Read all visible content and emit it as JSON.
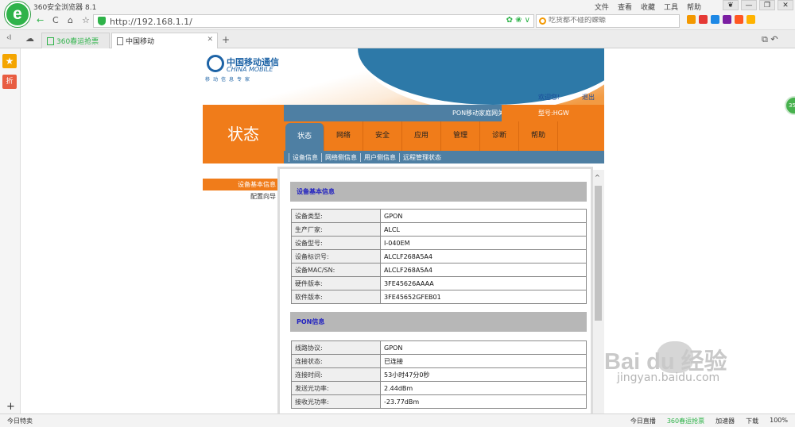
{
  "browser": {
    "logo_letter": "e",
    "app_name": "360安全浏览器 8.1",
    "top_menu": [
      "文件",
      "查看",
      "收藏",
      "工具",
      "帮助"
    ],
    "window_controls": [
      "❦",
      "—",
      "❐",
      "✕"
    ],
    "nav": {
      "back": "←",
      "refresh": "C",
      "home": "⌂",
      "fav": "☆",
      "left": "‹I",
      "cloud": "☁"
    },
    "url": "http://192.168.1.1/",
    "url_icons": "✿ ❀ ∨",
    "search_placeholder": "吃货都不碰的蝾螈",
    "tabs": [
      {
        "label": "360春运抢票"
      },
      {
        "label": "中国移动"
      }
    ],
    "tab_close": "✕",
    "new_tab": "+",
    "right_tools": "⧉ ↶",
    "sidebar_add": "+",
    "ext_badge": "35",
    "ext_colors": [
      "#f39800",
      "#e53935",
      "#1e88e5",
      "#7b1fa2",
      "#ff5722",
      "#ffb300"
    ]
  },
  "router_page": {
    "brand_cn": "中国移动通信",
    "brand_en": "CHINA MOBILE",
    "brand_slogan": "移动信息专家",
    "welcome": "欢迎您!",
    "logout": "退出",
    "section_title": "状态",
    "device_title": "PON移动家庭网关",
    "model_label": "型号:HGW",
    "main_nav": [
      {
        "label": "状态",
        "active": true
      },
      {
        "label": "网络",
        "active": false
      },
      {
        "label": "安全",
        "active": false
      },
      {
        "label": "应用",
        "active": false
      },
      {
        "label": "管理",
        "active": false
      },
      {
        "label": "诊断",
        "active": false
      },
      {
        "label": "帮助",
        "active": false
      }
    ],
    "sub_nav": [
      "设备信息",
      "网络侧信息",
      "用户侧信息",
      "远程管理状态"
    ],
    "left_menu": [
      {
        "label": "设备基本信息",
        "active": true
      },
      {
        "label": "配置向导",
        "active": false
      }
    ],
    "device_info": {
      "title": "设备基本信息",
      "rows": [
        {
          "label": "设备类型:",
          "value": "GPON"
        },
        {
          "label": "生产厂家:",
          "value": "ALCL"
        },
        {
          "label": "设备型号:",
          "value": "I-040EM"
        },
        {
          "label": "设备标识号:",
          "value": "ALCLF268A5A4"
        },
        {
          "label": "设备MAC/SN:",
          "value": "ALCLF268A5A4"
        },
        {
          "label": "硬件版本:",
          "value": "3FE45626AAAA"
        },
        {
          "label": "软件版本:",
          "value": "3FE45652GFEB01"
        }
      ]
    },
    "pon_info": {
      "title": "PON信息",
      "rows": [
        {
          "label": "线路协议:",
          "value": "GPON"
        },
        {
          "label": "连接状态:",
          "value": "已连接"
        },
        {
          "label": "连接时间:",
          "value": "53小时47分0秒"
        },
        {
          "label": "发送光功率:",
          "value": "2.44dBm"
        },
        {
          "label": "接收光功率:",
          "value": "-23.77dBm"
        }
      ]
    },
    "colors": {
      "orange": "#f07c1a",
      "blue": "#4e7fa3"
    }
  },
  "watermark": {
    "main": "Bai  du 经验",
    "sub": "jingyan.baidu.com"
  },
  "status_bar": {
    "left": "今日特卖",
    "right": [
      {
        "label": "今日直播",
        "green": false
      },
      {
        "label": "360春运抢票",
        "green": true
      },
      {
        "label": "加速器",
        "green": false
      },
      {
        "label": "下载",
        "green": false
      },
      {
        "label": "100%",
        "green": false
      }
    ]
  }
}
